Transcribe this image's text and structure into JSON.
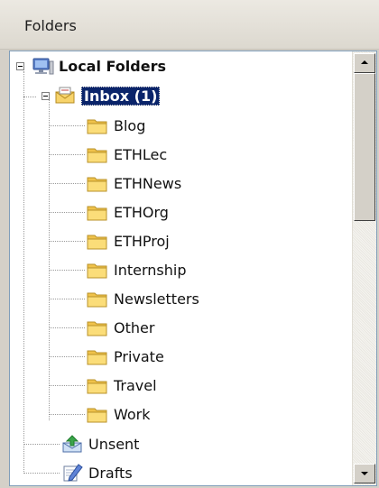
{
  "header": {
    "title": "Folders"
  },
  "tree": {
    "root": {
      "label": "Local Folders",
      "icon": "computer-icon"
    },
    "inbox": {
      "label": "Inbox (1)",
      "icon": "inbox-icon"
    },
    "inbox_children": [
      {
        "label": "Blog",
        "icon": "folder-icon"
      },
      {
        "label": "ETHLec",
        "icon": "folder-icon"
      },
      {
        "label": "ETHNews",
        "icon": "folder-icon"
      },
      {
        "label": "ETHOrg",
        "icon": "folder-icon"
      },
      {
        "label": "ETHProj",
        "icon": "folder-icon"
      },
      {
        "label": "Internship",
        "icon": "folder-icon"
      },
      {
        "label": "Newsletters",
        "icon": "folder-icon"
      },
      {
        "label": "Other",
        "icon": "folder-icon"
      },
      {
        "label": "Private",
        "icon": "folder-icon"
      },
      {
        "label": "Travel",
        "icon": "folder-icon"
      },
      {
        "label": "Work",
        "icon": "folder-icon"
      }
    ],
    "unsent": {
      "label": "Unsent",
      "icon": "outbox-icon"
    },
    "drafts": {
      "label": "Drafts",
      "icon": "drafts-icon"
    }
  },
  "colors": {
    "selection": "#0a246a",
    "folder": "#f3cf5f",
    "pane_border": "#7f9db9"
  }
}
